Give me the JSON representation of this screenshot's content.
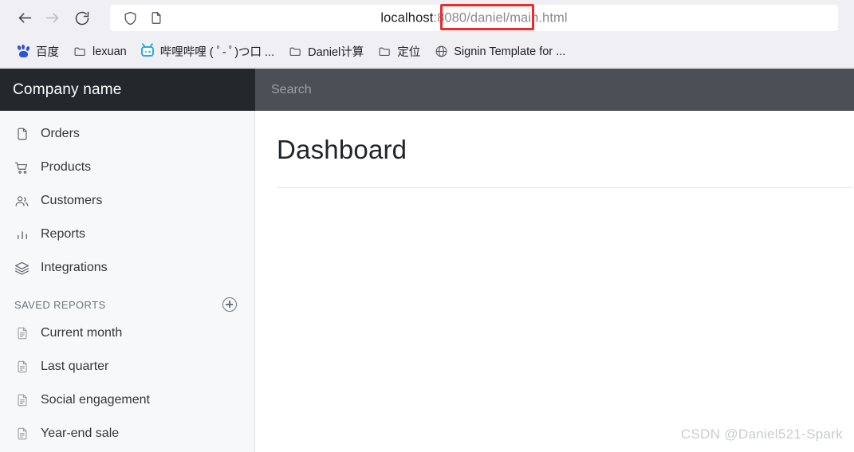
{
  "browser": {
    "back_label": "Back",
    "forward_label": "Forward",
    "reload_label": "Reload",
    "url_full": "localhost:8080/daniel/main.html",
    "url_host": "localhost",
    "url_path": ":8080/daniel/",
    "url_highlighted": "main.html",
    "highlight_color": "#ee2b2b",
    "shield_icon": "shield-icon",
    "page_icon": "page-info-icon"
  },
  "bookmarks": [
    {
      "label": "百度",
      "icon": "baidu-icon"
    },
    {
      "label": "lexuan",
      "icon": "folder-icon"
    },
    {
      "label": "哔哩哔哩 ( ﾟ- ﾟ)つ口 ...",
      "icon": "bilibili-icon"
    },
    {
      "label": "Daniel计算",
      "icon": "folder-icon"
    },
    {
      "label": "定位",
      "icon": "folder-icon"
    },
    {
      "label": "Signin Template for ...",
      "icon": "globe-icon"
    }
  ],
  "app": {
    "brand": "Company name",
    "brand_bg": "#24282c",
    "search_bg": "#4a5055",
    "search": {
      "value": "",
      "placeholder": "Search"
    }
  },
  "sidebar": {
    "bg": "#f7f8fa",
    "nav": [
      {
        "label": "Orders",
        "icon": "file-icon"
      },
      {
        "label": "Products",
        "icon": "shopping-cart-icon"
      },
      {
        "label": "Customers",
        "icon": "people-icon"
      },
      {
        "label": "Reports",
        "icon": "bar-chart-icon"
      },
      {
        "label": "Integrations",
        "icon": "layers-icon"
      }
    ],
    "saved_reports": {
      "heading": "SAVED REPORTS",
      "add_label": "Add saved report",
      "items": [
        {
          "label": "Current month",
          "icon": "document-text-icon"
        },
        {
          "label": "Last quarter",
          "icon": "document-text-icon"
        },
        {
          "label": "Social engagement",
          "icon": "document-text-icon"
        },
        {
          "label": "Year-end sale",
          "icon": "document-text-icon"
        }
      ]
    }
  },
  "main": {
    "title": "Dashboard"
  },
  "watermark": "CSDN @Daniel521-Spark"
}
